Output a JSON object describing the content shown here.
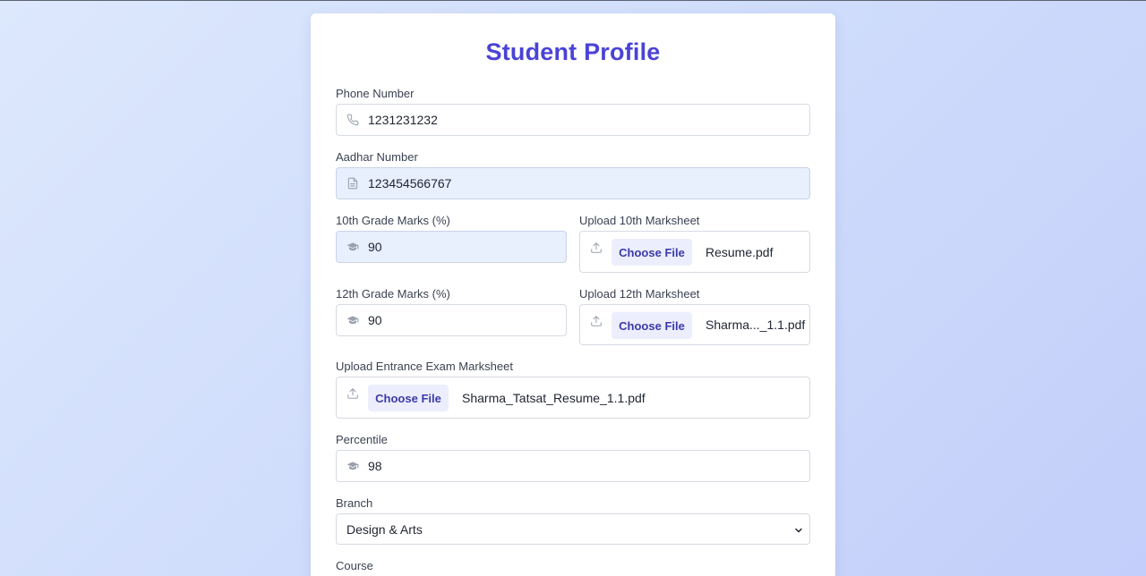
{
  "form": {
    "title": "Student Profile",
    "phone": {
      "label": "Phone Number",
      "value": "1231231232",
      "icon": "phone-icon"
    },
    "aadhar": {
      "label": "Aadhar Number",
      "value": "123454566767",
      "icon": "document-icon"
    },
    "tenth_marks": {
      "label": "10th Grade Marks (%)",
      "value": "90",
      "icon": "graduation-cap-icon"
    },
    "tenth_upload": {
      "label": "Upload 10th Marksheet",
      "button": "Choose File",
      "filename": "Resume.pdf",
      "icon": "upload-icon"
    },
    "twelfth_marks": {
      "label": "12th Grade Marks (%)",
      "value": "90",
      "icon": "graduation-cap-icon"
    },
    "twelfth_upload": {
      "label": "Upload 12th Marksheet",
      "button": "Choose File",
      "filename": "Sharma..._1.1.pdf",
      "icon": "upload-icon"
    },
    "entrance_upload": {
      "label": "Upload Entrance Exam Marksheet",
      "button": "Choose File",
      "filename": "Sharma_Tatsat_Resume_1.1.pdf",
      "icon": "upload-icon"
    },
    "percentile": {
      "label": "Percentile",
      "value": "98",
      "icon": "graduation-cap-icon"
    },
    "branch": {
      "label": "Branch",
      "selected": "Design & Arts"
    },
    "course": {
      "label": "Course"
    }
  },
  "colors": {
    "accent": "#4a43d6",
    "button_bg": "#eceefd",
    "button_text": "#3c3aa8",
    "filled_field_bg": "#e8effd"
  }
}
